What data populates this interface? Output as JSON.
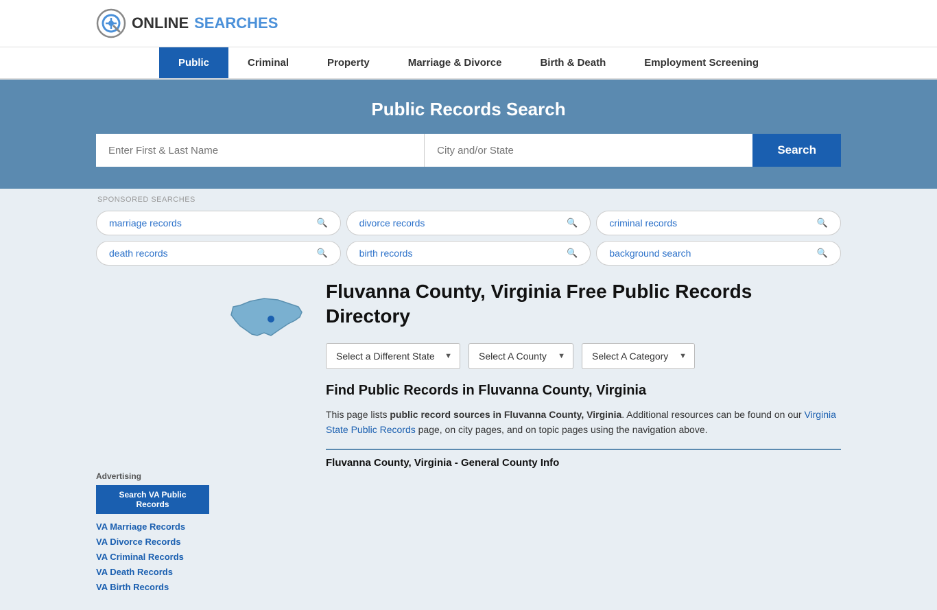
{
  "header": {
    "logo_text_online": "ONLINE",
    "logo_text_searches": "SEARCHES"
  },
  "nav": {
    "items": [
      {
        "label": "Public",
        "active": true
      },
      {
        "label": "Criminal",
        "active": false
      },
      {
        "label": "Property",
        "active": false
      },
      {
        "label": "Marriage & Divorce",
        "active": false
      },
      {
        "label": "Birth & Death",
        "active": false
      },
      {
        "label": "Employment Screening",
        "active": false
      }
    ]
  },
  "hero": {
    "title": "Public Records Search",
    "name_placeholder": "Enter First & Last Name",
    "location_placeholder": "City and/or State",
    "search_button": "Search"
  },
  "sponsored": {
    "label": "SPONSORED SEARCHES",
    "items": [
      {
        "text": "marriage records"
      },
      {
        "text": "divorce records"
      },
      {
        "text": "criminal records"
      },
      {
        "text": "death records"
      },
      {
        "text": "birth records"
      },
      {
        "text": "background search"
      }
    ]
  },
  "directory": {
    "title": "Fluvanna County, Virginia Free Public Records Directory",
    "dropdowns": {
      "state": "Select a Different State",
      "county": "Select A County",
      "category": "Select A Category"
    },
    "find_title": "Find Public Records in Fluvanna County, Virginia",
    "description_part1": "This page lists ",
    "description_bold": "public record sources in Fluvanna County, Virginia",
    "description_part2": ". Additional resources can be found on our ",
    "description_link": "Virginia State Public Records",
    "description_part3": " page, on city pages, and on topic pages using the navigation above.",
    "county_info_title": "Fluvanna County, Virginia - General County Info"
  },
  "sidebar": {
    "advertising_label": "Advertising",
    "ad_button": "Search VA Public Records",
    "links": [
      {
        "text": "VA Marriage Records"
      },
      {
        "text": "VA Divorce Records"
      },
      {
        "text": "VA Criminal Records"
      },
      {
        "text": "VA Death Records"
      },
      {
        "text": "VA Birth Records"
      }
    ]
  }
}
